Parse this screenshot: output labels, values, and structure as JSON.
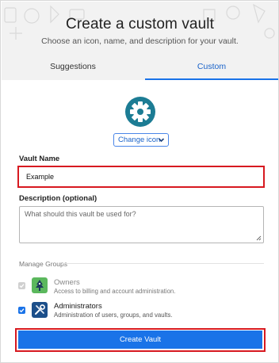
{
  "header": {
    "title": "Create a custom vault",
    "subtitle": "Choose an icon, name, and description for your vault."
  },
  "tabs": [
    {
      "label": "Suggestions",
      "active": false
    },
    {
      "label": "Custom",
      "active": true
    }
  ],
  "icon": {
    "name": "gear-icon",
    "color": "#1c7c94",
    "change_label": "Change icon"
  },
  "vault_name": {
    "label": "Vault Name",
    "value": "Example"
  },
  "description": {
    "label": "Description (optional)",
    "placeholder": "What should this vault be used for?"
  },
  "manage_groups": {
    "label": "Manage Groups",
    "groups": [
      {
        "name": "Owners",
        "description": "Access to billing and account administration.",
        "checked": true,
        "disabled": true,
        "icon": "owners-tree-icon"
      },
      {
        "name": "Administrators",
        "description": "Administration of users, groups, and vaults.",
        "checked": true,
        "disabled": false,
        "icon": "administrators-tools-icon"
      }
    ]
  },
  "create_button": {
    "label": "Create Vault"
  },
  "colors": {
    "accent": "#1a73e8",
    "highlight": "#d71920"
  }
}
